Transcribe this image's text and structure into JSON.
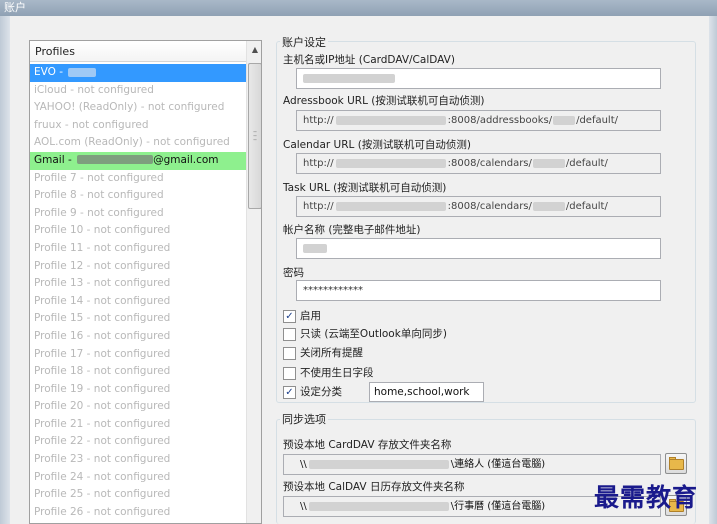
{
  "window": {
    "title": "账户"
  },
  "profiles": {
    "header": "Profiles",
    "items": [
      {
        "label": "EVO - ",
        "state": "selected-blue",
        "redacted": true
      },
      {
        "label": "iCloud - not configured",
        "state": "disabled"
      },
      {
        "label": "YAHOO! (ReadOnly) - not configured",
        "state": "disabled"
      },
      {
        "label": "fruux - not configured",
        "state": "disabled"
      },
      {
        "label": "AOL.com (ReadOnly) - not configured",
        "state": "disabled"
      },
      {
        "label": "Gmail - ",
        "suffix": "@gmail.com",
        "state": "selected-green",
        "redacted": true
      },
      {
        "label": "Profile 7 - not configured",
        "state": "disabled"
      },
      {
        "label": "Profile 8 - not configured",
        "state": "disabled"
      },
      {
        "label": "Profile 9 - not configured",
        "state": "disabled"
      },
      {
        "label": "Profile 10 - not configured",
        "state": "disabled"
      },
      {
        "label": "Profile 11 - not configured",
        "state": "disabled"
      },
      {
        "label": "Profile 12 - not configured",
        "state": "disabled"
      },
      {
        "label": "Profile 13 - not configured",
        "state": "disabled"
      },
      {
        "label": "Profile 14 - not configured",
        "state": "disabled"
      },
      {
        "label": "Profile 15 - not configured",
        "state": "disabled"
      },
      {
        "label": "Profile 16 - not configured",
        "state": "disabled"
      },
      {
        "label": "Profile 17 - not configured",
        "state": "disabled"
      },
      {
        "label": "Profile 18 - not configured",
        "state": "disabled"
      },
      {
        "label": "Profile 19 - not configured",
        "state": "disabled"
      },
      {
        "label": "Profile 20 - not configured",
        "state": "disabled"
      },
      {
        "label": "Profile 21 - not configured",
        "state": "disabled"
      },
      {
        "label": "Profile 22 - not configured",
        "state": "disabled"
      },
      {
        "label": "Profile 23 - not configured",
        "state": "disabled"
      },
      {
        "label": "Profile 24 - not configured",
        "state": "disabled"
      },
      {
        "label": "Profile 25 - not configured",
        "state": "disabled"
      },
      {
        "label": "Profile 26 - not configured",
        "state": "disabled"
      }
    ]
  },
  "account_settings": {
    "group_title": "账户设定",
    "host_label": "主机名或IP地址 (CardDAV/CalDAV)",
    "addressbook_label": "Adressbook URL (按测试联机可自动侦测)",
    "addressbook_prefix": "http://",
    "addressbook_suffix": ":8008/addressbooks/",
    "addressbook_tail": "/default/",
    "calendar_label": "Calendar URL (按测试联机可自动侦测)",
    "calendar_prefix": "http://",
    "calendar_suffix": ":8008/calendars/",
    "calendar_tail": "/default/",
    "task_label": "Task URL (按测试联机可自动侦测)",
    "task_prefix": "http://",
    "task_suffix": ":8008/calendars/",
    "task_tail": "/default/",
    "account_name_label": "帐户名称 (完整电子邮件地址)",
    "password_label": "密码",
    "password_value": "************",
    "enable": {
      "label": "启用",
      "checked": true
    },
    "readonly": {
      "label": "只读 (云端至Outlook单向同步)",
      "checked": false
    },
    "disable_reminders": {
      "label": "关闭所有提醒",
      "checked": false
    },
    "no_birthday": {
      "label": "不使用生日字段",
      "checked": false
    },
    "set_categories": {
      "label": "设定分类",
      "checked": true
    },
    "categories_value": "home,school,work"
  },
  "sync_options": {
    "group_title": "同步选项",
    "carddav_folder_label": "预设本地 CardDAV 存放文件夹名称",
    "carddav_folder_prefix": "\\\\",
    "carddav_folder_suffix": "\\連絡人 (僅這台電腦)",
    "caldav_folder_label": "预设本地 CalDAV 日历存放文件夹名称",
    "caldav_folder_prefix": "\\\\",
    "caldav_folder_suffix": "\\行事曆 (僅這台電腦)"
  },
  "watermark": "最需教育",
  "colors": {
    "selection_blue": "#3399ff",
    "selection_green": "#8ef08e",
    "disabled_text": "#b8b8b8"
  }
}
